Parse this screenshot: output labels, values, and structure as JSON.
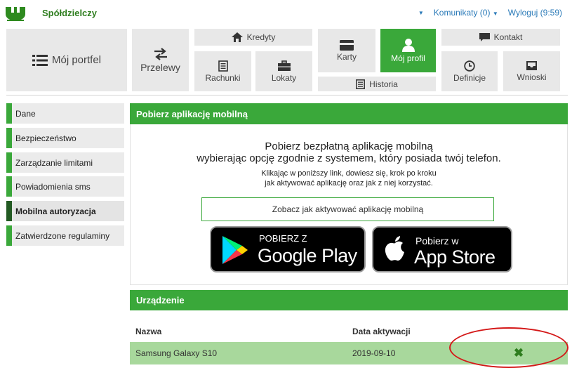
{
  "header": {
    "brand": "Spółdzielczy",
    "messages": "Komunikaty (0)",
    "logout": "Wyloguj (9:59)"
  },
  "nav": {
    "portfel": "Mój portfel",
    "przelewy": "Przelewy",
    "kredyty": "Kredyty",
    "rachunki": "Rachunki",
    "lokaty": "Lokaty",
    "karty": "Karty",
    "historia": "Historia",
    "profil": "Mój profil",
    "kontakt": "Kontakt",
    "definicje": "Definicje",
    "wnioski": "Wnioski"
  },
  "sidebar": {
    "items": [
      {
        "label": "Dane"
      },
      {
        "label": "Bezpieczeństwo"
      },
      {
        "label": "Zarządzanie limitami"
      },
      {
        "label": "Powiadomienia sms"
      },
      {
        "label": "Mobilna autoryzacja"
      },
      {
        "label": "Zatwierdzone regulaminy"
      }
    ]
  },
  "mobile_app": {
    "title": "Pobierz aplikację mobilną",
    "line1": "Pobierz bezpłatną aplikację mobilną",
    "line2": "wybierając opcję zgodnie z systemem, który posiada twój telefon.",
    "line3": "Klikając w poniższy link, dowiesz się, krok po kroku",
    "line4": "jak aktywować aplikację oraz jak z niej korzystać.",
    "link": "Zobacz jak aktywować aplikację mobilną",
    "google_small": "POBIERZ Z",
    "google_big": "Google Play",
    "apple_small": "Pobierz w",
    "apple_big": "App Store"
  },
  "device": {
    "title": "Urządzenie",
    "col_name": "Nazwa",
    "col_date": "Data aktywacji",
    "row": {
      "name": "Samsung Galaxy S10",
      "date": "2019-09-10"
    },
    "remove_glyph": "✖"
  },
  "colors": {
    "accent": "#3aa83a",
    "dark_accent": "#235a23",
    "row_highlight": "#a8d89c",
    "link": "#2a7ab8",
    "annotation": "#d41818"
  }
}
